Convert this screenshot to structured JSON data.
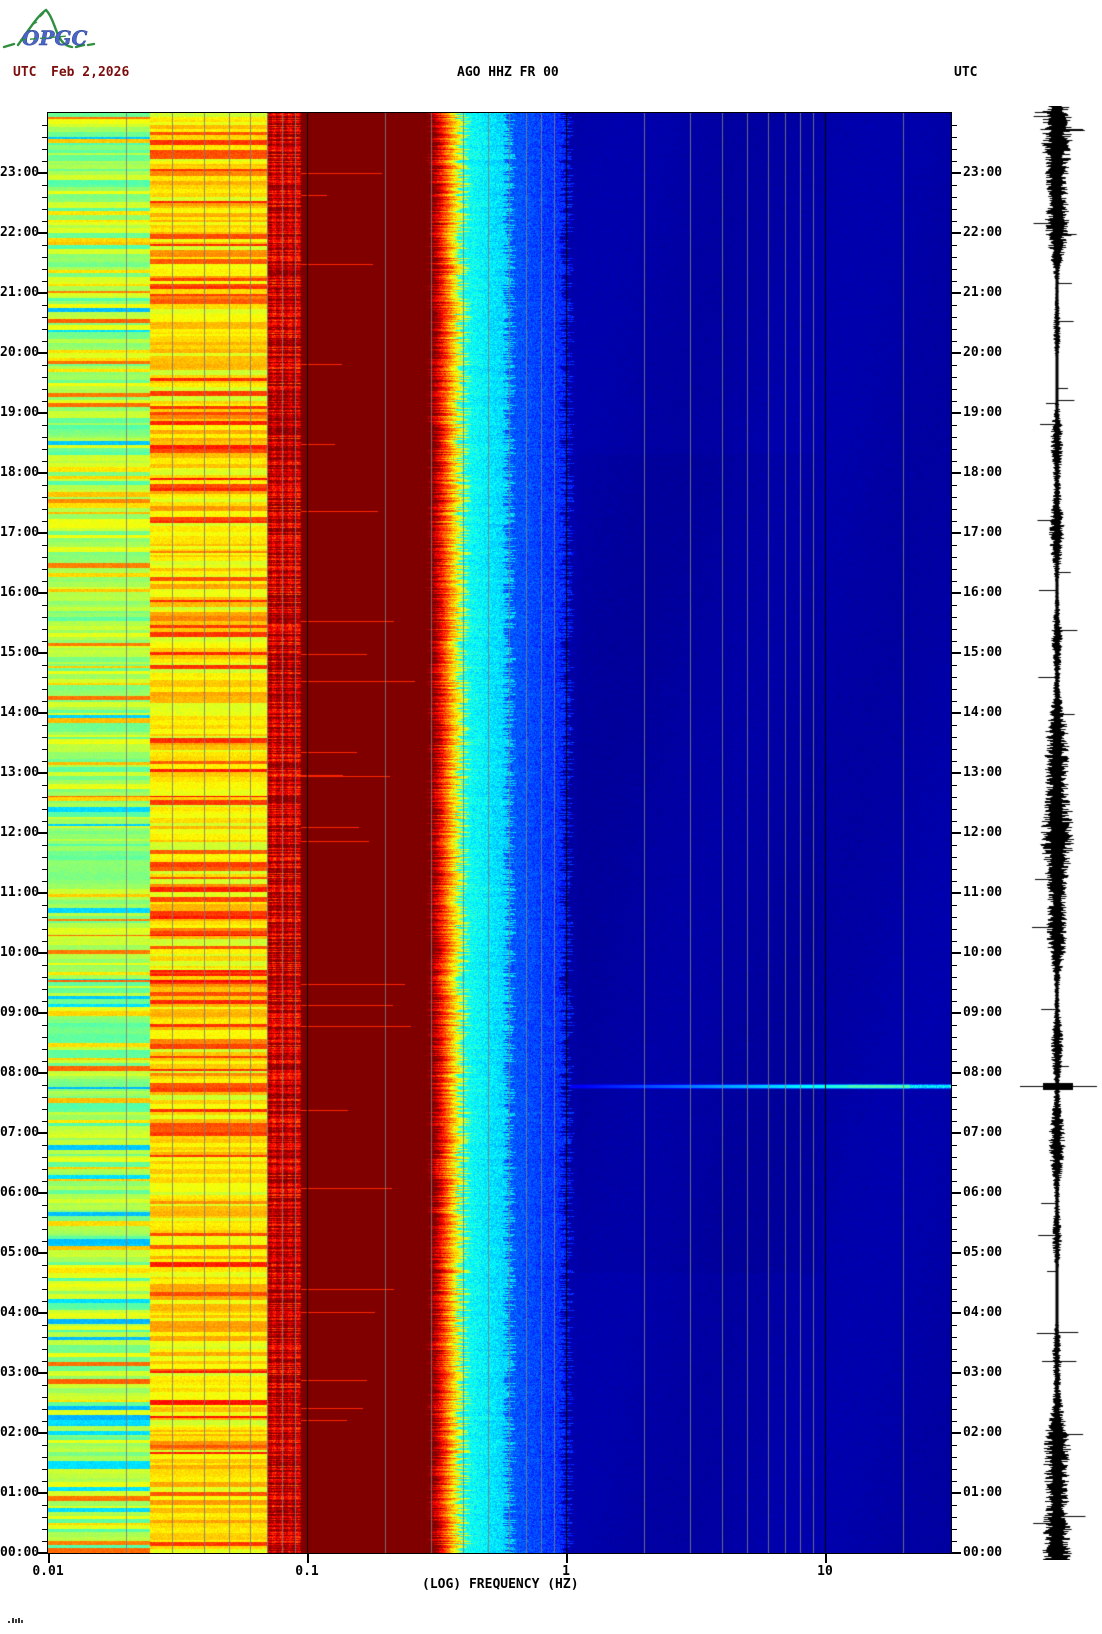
{
  "header": {
    "utc_left": "UTC",
    "date": "Feb 2,2026",
    "station_title": "AGO HHZ FR 00",
    "utc_right": "UTC",
    "date_color": "#7d0d0d"
  },
  "logo": {
    "text": "OPGC",
    "text_color": "#4a67c8",
    "ridge_color": "#2f8f3f"
  },
  "chart_data": {
    "type": "heatmap",
    "subtype": "seismic-daily-spectrogram",
    "title": "AGO HHZ FR 00",
    "xlabel": "(LOG) FREQUENCY (HZ)",
    "x_scale": "log",
    "x_range_hz": [
      0.01,
      30
    ],
    "x_tick_values": [
      0.01,
      0.1,
      1,
      10
    ],
    "x_tick_labels": [
      "0.01",
      "0.1",
      "1",
      "10"
    ],
    "y_axis": "UTC time of day, 00:00 at bottom to 24:00 at top, minor ticks every 12 minutes",
    "hour_labels": [
      "23:00",
      "22:00",
      "21:00",
      "20:00",
      "19:00",
      "18:00",
      "17:00",
      "16:00",
      "15:00",
      "14:00",
      "13:00",
      "12:00",
      "11:00",
      "10:00",
      "09:00",
      "08:00",
      "07:00",
      "06:00",
      "05:00",
      "04:00",
      "03:00",
      "02:00",
      "01:00",
      "00:00"
    ],
    "grid": "vertical log gridlines: gray minors at 2-9 of each decade plus 20 Hz, black lines at 0.1, 1 and 10 Hz",
    "legend": "none",
    "palette": "jet",
    "bands": [
      {
        "f_hz": [
          0.01,
          0.0248
        ],
        "style": "banded",
        "jet_base": 0.5,
        "jet_var": 0.17,
        "desc": "green/yellow horizontal banding, sporadic cyan and orange/red lines"
      },
      {
        "f_hz": [
          0.0248,
          0.07
        ],
        "style": "banded",
        "jet_base": 0.62,
        "jet_var": 0.16,
        "desc": "yellow/orange banding with frequent red lines"
      },
      {
        "f_hz": [
          0.07,
          0.095
        ],
        "style": "checker",
        "jet_base": 0.86,
        "jet_var": 0.14,
        "desc": "bright red / dark maroon mottled band"
      },
      {
        "f_hz": [
          0.095,
          0.3
        ],
        "style": "solid",
        "jet_base": 1.0,
        "jet_var": 0.0,
        "desc": "saturated dark-red microseism band, rare bright red streaks"
      },
      {
        "f_hz": [
          0.3,
          0.4
        ],
        "style": "ragged",
        "jet_base": 0.8,
        "jet_var": 0.1,
        "desc": "ragged red-orange-yellow transition edge"
      },
      {
        "f_hz": [
          0.4,
          0.6
        ],
        "style": "speckle",
        "jet_base": 0.34,
        "jet_var": 0.1,
        "desc": "cyan speckle"
      },
      {
        "f_hz": [
          0.6,
          1.0
        ],
        "style": "speckle",
        "jet_base": 0.16,
        "jet_var": 0.08,
        "desc": "blue speckle fading darker"
      },
      {
        "f_hz": [
          1.0,
          30
        ],
        "style": "flat",
        "jet_base": 0.035,
        "jet_var": 0.02,
        "desc": "dark navy background with faint mottling"
      }
    ],
    "event": {
      "time_utc": "~07:45",
      "freq_range_hz": [
        1,
        30
      ],
      "appearance": "thin light-blue/cyan horizontal streak, brightest between 8 and 20 Hz"
    },
    "side_trace": {
      "kind": "24-h seismogram amplitude strip along right edge",
      "color": "#000000",
      "spike_time_utc": "~07:45"
    }
  }
}
